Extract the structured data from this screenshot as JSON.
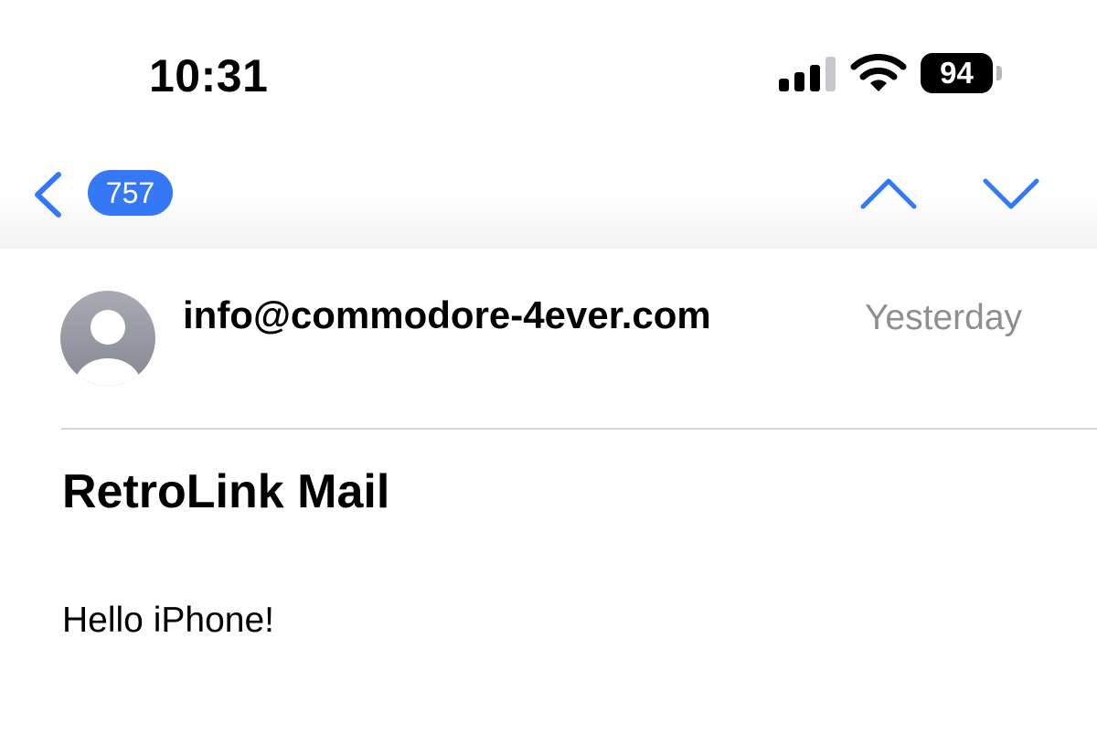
{
  "status_bar": {
    "time": "10:31",
    "battery_level": "94"
  },
  "nav": {
    "unread_count": "757",
    "accent_color": "#3478f6"
  },
  "message": {
    "sender": "info@commodore-4ever.com",
    "date": "Yesterday",
    "subject": "RetroLink Mail",
    "body": "Hello iPhone!"
  },
  "icons": [
    "cellular-signal-icon",
    "wifi-icon",
    "battery-icon",
    "chevron-left-icon",
    "chevron-up-icon",
    "chevron-down-icon",
    "avatar-placeholder-icon"
  ]
}
